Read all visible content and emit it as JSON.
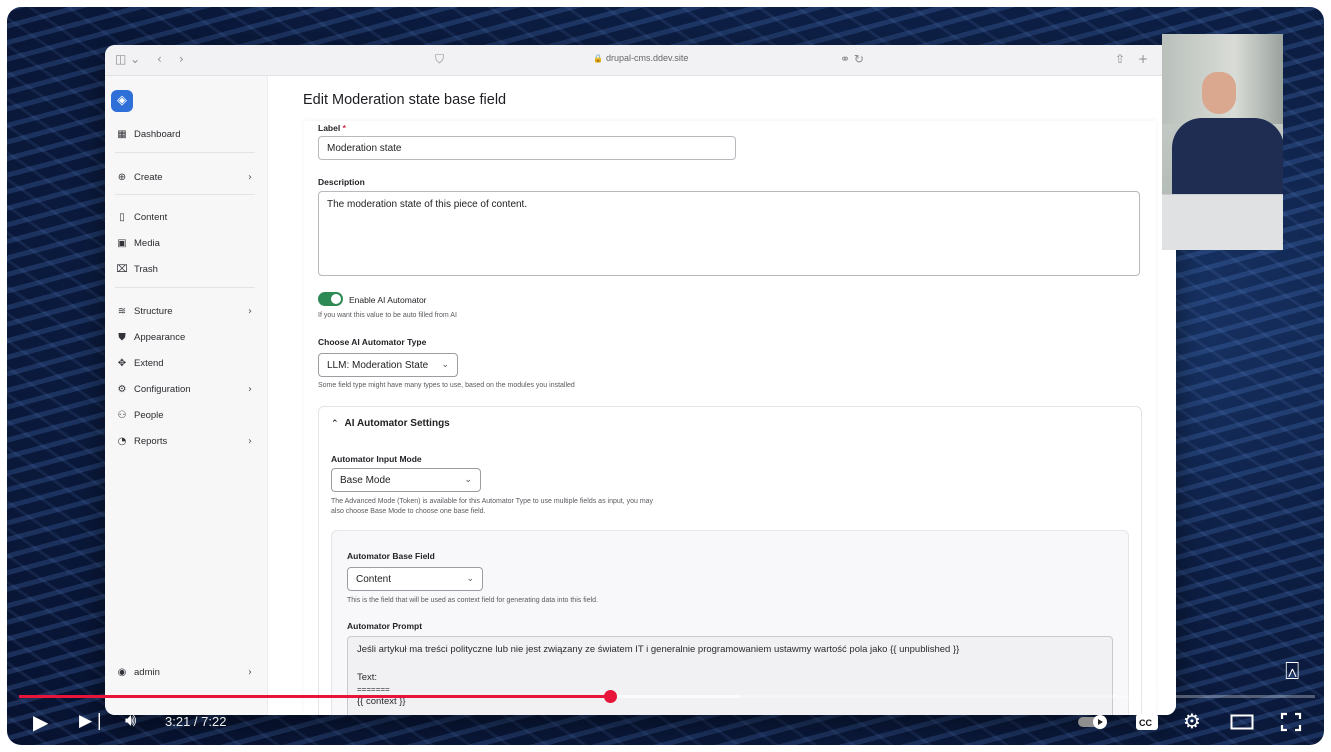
{
  "browser": {
    "url": "drupal-cms.ddev.site"
  },
  "sidebar": {
    "items": [
      {
        "label": "Dashboard",
        "icon": "dashboard-icon"
      },
      {
        "label": "Create",
        "icon": "plus-circle-icon"
      },
      {
        "label": "Content",
        "icon": "document-icon"
      },
      {
        "label": "Media",
        "icon": "image-icon"
      },
      {
        "label": "Trash",
        "icon": "trash-icon"
      },
      {
        "label": "Structure",
        "icon": "layers-icon"
      },
      {
        "label": "Appearance",
        "icon": "brush-icon"
      },
      {
        "label": "Extend",
        "icon": "puzzle-icon"
      },
      {
        "label": "Configuration",
        "icon": "gear-icon"
      },
      {
        "label": "People",
        "icon": "people-icon"
      },
      {
        "label": "Reports",
        "icon": "chart-icon"
      }
    ],
    "user": "admin"
  },
  "main": {
    "title": "Edit Moderation state base field",
    "label_field": {
      "label": "Label",
      "value": "Moderation state"
    },
    "description_field": {
      "label": "Description",
      "value": "The moderation state of this piece of content."
    },
    "automator_toggle": {
      "label": "Enable AI Automator",
      "help": "If you want this value to be auto filled from AI",
      "enabled": true
    },
    "automator_type": {
      "label": "Choose AI Automator Type",
      "value": "LLM: Moderation State",
      "help": "Some field type might have many types to use, based on the modules you installed"
    },
    "settings": {
      "title": "AI Automator Settings",
      "input_mode": {
        "label": "Automator Input Mode",
        "value": "Base Mode",
        "help_line1": "The Advanced Mode (Token) is available for this Automator Type to use multiple fields as input, you may",
        "help_line2": "also choose Base Mode to choose one base field."
      },
      "base_field": {
        "label": "Automator Base Field",
        "value": "Content",
        "help": "This is the field that will be used as context field for generating data into this field."
      },
      "prompt": {
        "label": "Automator Prompt",
        "line1": "Jeśli artykuł ma treści polityczne lub nie jest związany ze światem IT i generalnie programowaniem ustawmy wartość pola jako {{ unpublished }}",
        "line2": "",
        "line3": "Text:",
        "line4": "=======",
        "line5": "{{ context }}"
      }
    }
  },
  "player": {
    "time": "3:21 / 7:22",
    "progress": 0.456,
    "buffered": 0.556,
    "accent": "#e8143a"
  }
}
